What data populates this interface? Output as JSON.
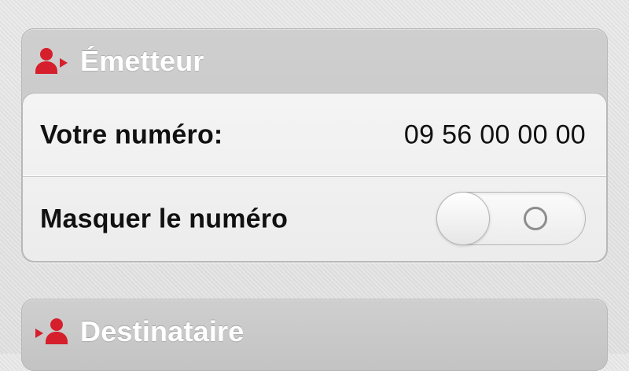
{
  "sections": {
    "emitter": {
      "title": "Émetteur",
      "icon": "person-arrow-right-icon",
      "rows": [
        {
          "label": "Votre numéro:",
          "value": "09 56 00 00 00"
        },
        {
          "label": "Masquer le numéro",
          "toggle_state": "off"
        }
      ]
    },
    "recipient": {
      "title": "Destinataire",
      "icon": "arrow-person-icon"
    }
  },
  "colors": {
    "accent": "#d61f2c",
    "panel": "#c9c9c9",
    "card": "#efefef",
    "text": "#111111"
  }
}
